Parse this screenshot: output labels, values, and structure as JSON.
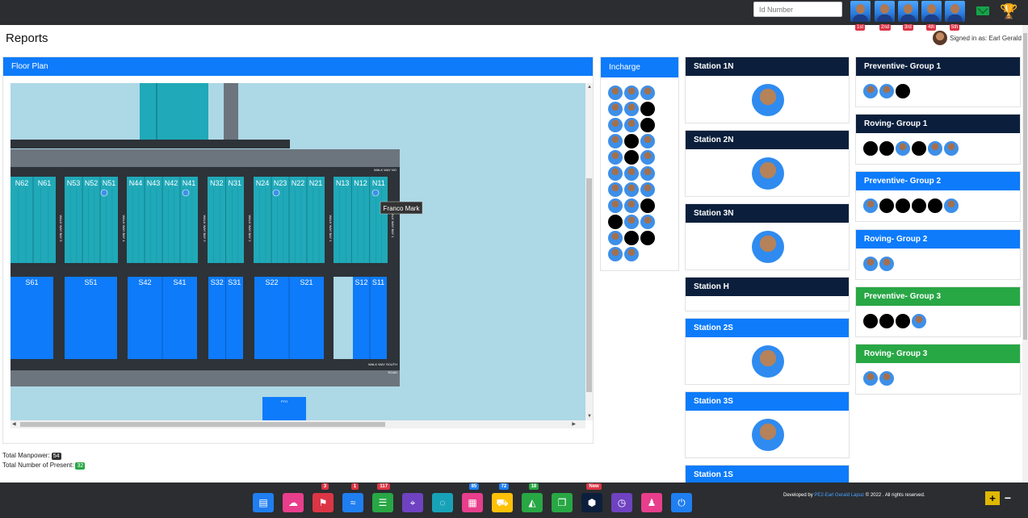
{
  "topbar": {
    "id_placeholder": "Id Number",
    "ranks": [
      "1st",
      "2nd",
      "3rd",
      "4th",
      "5th"
    ],
    "mail_icon": "mail-icon",
    "trophy_icon": "trophy-icon"
  },
  "page": {
    "title": "Reports",
    "signed_in": "Signed in as: Earl Gerald"
  },
  "floor_plan": {
    "header": "Floor Plan",
    "north_labels": [
      "N62",
      "N61",
      "N53",
      "N52",
      "N51",
      "N44",
      "N43",
      "N42",
      "N41",
      "N32",
      "N31",
      "N24",
      "N23",
      "N22",
      "N21",
      "N13",
      "N12",
      "N11"
    ],
    "south_labels": [
      "S61",
      "S51",
      "S42",
      "S41",
      "S32",
      "S31",
      "S22",
      "S21",
      "S12",
      "S11"
    ],
    "walkways": [
      "WALK WAY BAY 5",
      "WALK WAY BAY 4",
      "WALK WAY BAY 3",
      "WALK WAY BAY 2",
      "WALK WAY BAY 1"
    ],
    "walkway_north": "WALK WAY NO",
    "walkway_south": "WALK WAY SOUTH",
    "road": "ROAD",
    "pto": "PTO",
    "tooltip": "Franco Mark"
  },
  "totals": {
    "manpower_label": "Total Manpower:",
    "manpower_value": "54",
    "present_label": "Total Number of Present:",
    "present_value": "32"
  },
  "incharge": {
    "header": "Incharge",
    "people": [
      "p",
      "p",
      "p",
      "p",
      "p",
      "b",
      "p",
      "p",
      "b",
      "p",
      "b",
      "p",
      "p",
      "b",
      "p",
      "p",
      "p",
      "p",
      "p",
      "p",
      "p",
      "p",
      "p",
      "b",
      "b",
      "p",
      "p",
      "p",
      "b",
      "b",
      "p",
      "p"
    ]
  },
  "stations": [
    {
      "name": "Station 1N",
      "theme": "navy",
      "has_person": true
    },
    {
      "name": "Station 2N",
      "theme": "navy",
      "has_person": true
    },
    {
      "name": "Station 3N",
      "theme": "navy",
      "has_person": true
    },
    {
      "name": "Station H",
      "theme": "navy",
      "has_person": false
    },
    {
      "name": "Station 2S",
      "theme": "blue",
      "has_person": true
    },
    {
      "name": "Station 3S",
      "theme": "blue",
      "has_person": true
    },
    {
      "name": "Station 1S",
      "theme": "blue",
      "has_person": false
    }
  ],
  "groups": [
    {
      "name": "Preventive- Group 1",
      "theme": "navy",
      "people": [
        "p",
        "p",
        "b"
      ]
    },
    {
      "name": "Roving- Group 1",
      "theme": "navy",
      "people": [
        "b",
        "b",
        "p",
        "b",
        "p",
        "p"
      ]
    },
    {
      "name": "Preventive- Group 2",
      "theme": "blue",
      "people": [
        "p",
        "b",
        "b",
        "b",
        "b",
        "p"
      ]
    },
    {
      "name": "Roving- Group 2",
      "theme": "blue",
      "people": [
        "p",
        "p"
      ]
    },
    {
      "name": "Preventive- Group 3",
      "theme": "green",
      "people": [
        "b",
        "b",
        "b",
        "p"
      ]
    },
    {
      "name": "Roving- Group 3",
      "theme": "green",
      "people": [
        "p",
        "p"
      ]
    }
  ],
  "bottom_buttons": [
    {
      "icon": "archive-icon",
      "color": "#1f7ef0",
      "badge": ""
    },
    {
      "icon": "cloud-upload-icon",
      "color": "#e83e8c",
      "badge": ""
    },
    {
      "icon": "flag-icon",
      "color": "#dc3545",
      "badge": "3"
    },
    {
      "icon": "swimmer-icon",
      "color": "#1f7ef0",
      "badge": "1"
    },
    {
      "icon": "list-check-icon",
      "color": "#28a745",
      "badge": "117"
    },
    {
      "icon": "map-marker-icon",
      "color": "#6f42c1",
      "badge": ""
    },
    {
      "icon": "spinner-icon",
      "color": "#17a2b8",
      "badge": ""
    },
    {
      "icon": "calendar-icon",
      "color": "#e83e8c",
      "badge": "85"
    },
    {
      "icon": "cart-icon",
      "color": "#ffc107",
      "badge": "72"
    },
    {
      "icon": "shopping-bag-icon",
      "color": "#28a745",
      "badge": "18"
    },
    {
      "icon": "copy-icon",
      "color": "#28a745",
      "badge": ""
    },
    {
      "icon": "cube-icon",
      "color": "#0b1f3c",
      "badge": "New"
    },
    {
      "icon": "clock-icon",
      "color": "#6f42c1",
      "badge": ""
    },
    {
      "icon": "user-edit-icon",
      "color": "#e83e8c",
      "badge": ""
    },
    {
      "icon": "power-icon",
      "color": "#1f7ef0",
      "badge": ""
    }
  ],
  "footer": {
    "prefix": "Developed by ",
    "author": "PE2-Earl Gerald Lapuz",
    "suffix": " © 2022 . All rights reserved."
  },
  "zoom": {
    "plus": "+",
    "minus": "−"
  },
  "colors": {
    "accent": "#0d7bfa",
    "navy": "#0b1f3c",
    "green": "#28a745",
    "floor_bg": "#add8e6",
    "north_bay": "#20a9b8",
    "south_bay": "#0d7bfa"
  }
}
